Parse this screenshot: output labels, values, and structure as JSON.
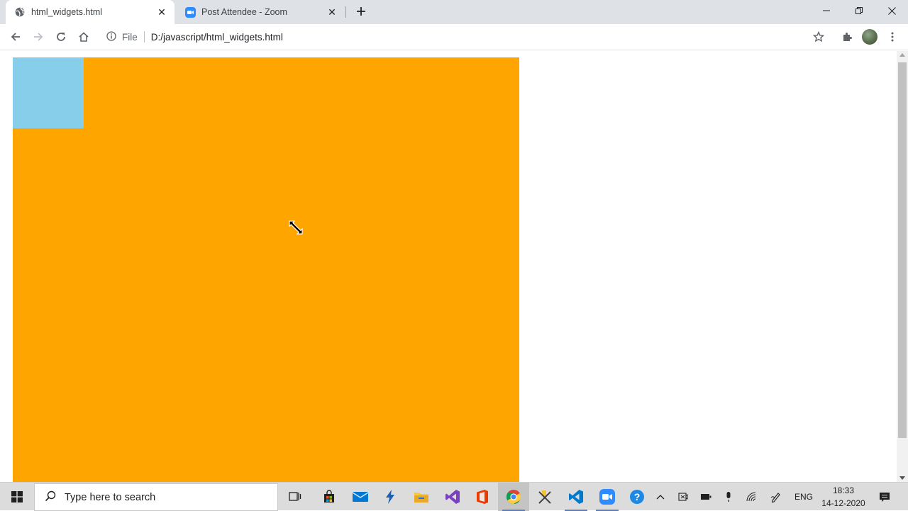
{
  "browser": {
    "tabs": [
      {
        "title": "html_widgets.html",
        "active": true
      },
      {
        "title": "Post Attendee - Zoom",
        "active": false
      }
    ],
    "address": {
      "scheme_label": "File",
      "url": "D:/javascript/html_widgets.html"
    }
  },
  "page": {
    "orange_color": "#FFA500",
    "blue_color": "#87CEEB"
  },
  "taskbar": {
    "search_placeholder": "Type here to search",
    "language": "ENG",
    "time": "18:33",
    "date": "14-12-2020"
  },
  "colors": {
    "tabstrip": "#dee1e6",
    "taskbar": "#dcdcdc",
    "zoom_blue": "#2d8cff",
    "chrome_accent": "#5a7ec2"
  }
}
